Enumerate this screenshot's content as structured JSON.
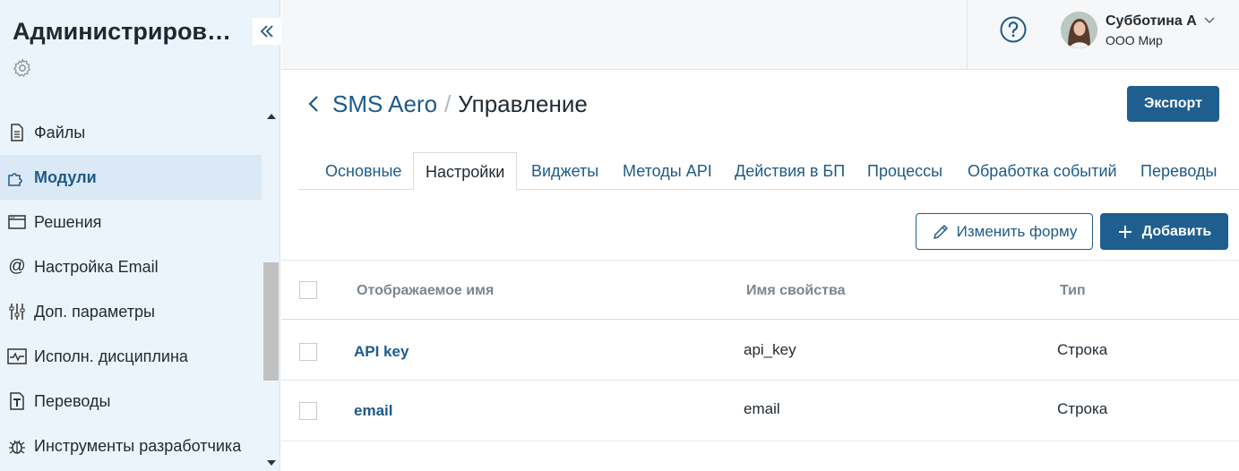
{
  "sidebar": {
    "title": "Администриров…",
    "items": [
      {
        "label": "Файлы",
        "icon": "file-icon"
      },
      {
        "label": "Модули",
        "icon": "puzzle-icon",
        "active": true
      },
      {
        "label": "Решения",
        "icon": "window-icon"
      },
      {
        "label": "Настройка Email",
        "icon": "at-icon"
      },
      {
        "label": "Доп. параметры",
        "icon": "sliders-icon"
      },
      {
        "label": "Исполн. дисциплина",
        "icon": "pulse-icon"
      },
      {
        "label": "Переводы",
        "icon": "text-icon"
      },
      {
        "label": "Инструменты разработчика",
        "icon": "bug-icon"
      }
    ]
  },
  "user": {
    "name": "Субботина А",
    "org": "ООО Мир"
  },
  "header": {
    "breadcrumb_link": "SMS Aero",
    "separator": "/",
    "current": "Управление",
    "export_label": "Экспорт"
  },
  "tabs": [
    {
      "label": "Основные"
    },
    {
      "label": "Настройки",
      "active": true
    },
    {
      "label": "Виджеты"
    },
    {
      "label": "Методы API"
    },
    {
      "label": "Действия в БП"
    },
    {
      "label": "Процессы"
    },
    {
      "label": "Обработка событий"
    },
    {
      "label": "Переводы"
    }
  ],
  "toolbar": {
    "edit_form_label": "Изменить форму",
    "add_label": "Добавить"
  },
  "table": {
    "headers": [
      "Отображаемое имя",
      "Имя свойства",
      "Тип"
    ],
    "rows": [
      {
        "display_name": "API key",
        "property": "api_key",
        "type": "Строка"
      },
      {
        "display_name": "email",
        "property": "email",
        "type": "Строка"
      }
    ]
  },
  "colors": {
    "accent": "#1f5f8f",
    "sidebar_bg": "#ecf4fb",
    "link": "#1e5a8a"
  }
}
